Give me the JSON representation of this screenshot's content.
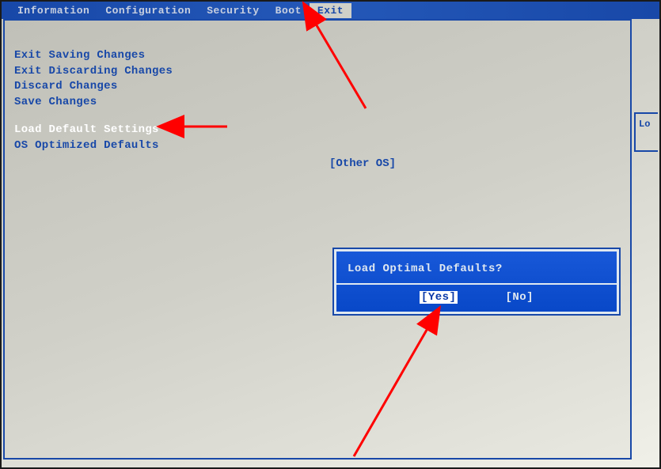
{
  "tabs": {
    "information": "Information",
    "configuration": "Configuration",
    "security": "Security",
    "boot": "Boot",
    "exit": "Exit"
  },
  "menu": {
    "exit_saving": "Exit Saving Changes",
    "exit_discarding": "Exit Discarding Changes",
    "discard_changes": "Discard Changes",
    "save_changes": "Save Changes",
    "load_default": "Load Default Settings",
    "os_optimized": "OS Optimized Defaults"
  },
  "option_value": "[Other OS]",
  "side_label": "Lo",
  "dialog": {
    "title": "Load Optimal Defaults?",
    "yes": "[Yes]",
    "no": "[No]"
  }
}
